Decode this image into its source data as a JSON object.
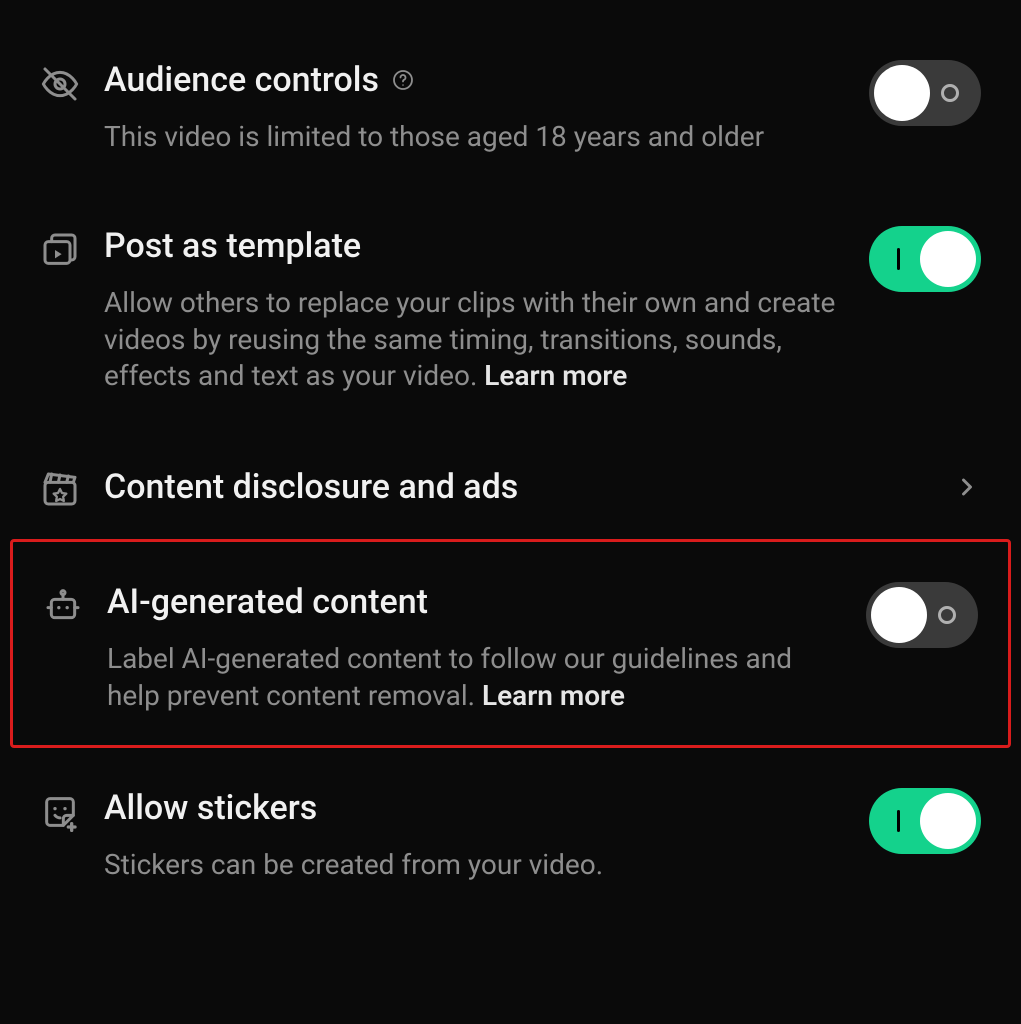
{
  "settings": {
    "audience": {
      "title": "Audience controls",
      "description": "This video is limited to those aged 18 years and older",
      "enabled": false
    },
    "template": {
      "title": "Post as template",
      "description": "Allow others to replace your clips with their own and create videos by reusing the same timing, transitions, sounds, effects and text as your video. ",
      "learn_more": "Learn more",
      "enabled": true
    },
    "disclosure": {
      "title": "Content disclosure and ads"
    },
    "ai": {
      "title": "AI-generated content",
      "description": "Label AI-generated content to follow our guidelines and help prevent content removal. ",
      "learn_more": "Learn more",
      "enabled": false
    },
    "stickers": {
      "title": "Allow stickers",
      "description": "Stickers can be created from your video.",
      "enabled": true
    }
  }
}
